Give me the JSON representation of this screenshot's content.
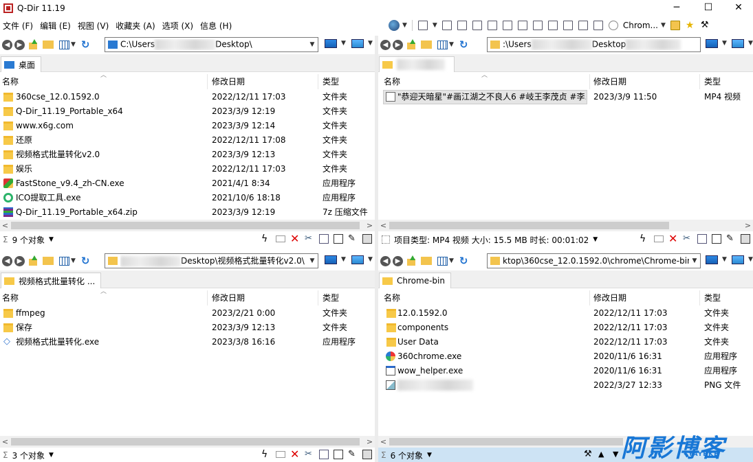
{
  "window": {
    "title": "Q-Dir 11.19",
    "min": "─",
    "max": "☐",
    "close": "✕"
  },
  "menu": [
    "文件 (F)",
    "编辑 (E)",
    "视图 (V)",
    "收藏夹 (A)",
    "选项 (X)",
    "信息 (H)"
  ],
  "toolbar": {
    "browser_label": "Chrom..."
  },
  "columns": {
    "name": "名称",
    "date": "修改日期",
    "type": "类型"
  },
  "panes": {
    "tl": {
      "address": "C:\\Users",
      "address_tail": "Desktop\\",
      "tab": "桌面",
      "rows": [
        {
          "name": "360cse_12.0.1592.0",
          "date": "2022/12/11 17:03",
          "type": "文件夹",
          "icon": "folder-icon"
        },
        {
          "name": "Q-Dir_11.19_Portable_x64",
          "date": "2023/3/9 12:19",
          "type": "文件夹",
          "icon": "folder-icon"
        },
        {
          "name": "www.x6g.com",
          "date": "2023/3/9 12:14",
          "type": "文件夹",
          "icon": "folder-icon"
        },
        {
          "name": "还原",
          "date": "2022/12/11 17:08",
          "type": "文件夹",
          "icon": "folder-icon"
        },
        {
          "name": "视频格式批量转化v2.0",
          "date": "2023/3/9 12:13",
          "type": "文件夹",
          "icon": "folder-icon"
        },
        {
          "name": "娱乐",
          "date": "2022/12/11 17:03",
          "type": "文件夹",
          "icon": "folder-icon"
        },
        {
          "name": "FastStone_v9.4_zh-CN.exe",
          "date": "2021/4/1 8:34",
          "type": "应用程序",
          "icon": "faststone-icon"
        },
        {
          "name": "ICO提取工具.exe",
          "date": "2021/10/6 18:18",
          "type": "应用程序",
          "icon": "ico-tool-icon"
        },
        {
          "name": "Q-Dir_11.19_Portable_x64.zip",
          "date": "2023/3/9 12:19",
          "type": "7z 压缩文件",
          "icon": "archive-icon"
        }
      ],
      "status": "9 个对象"
    },
    "tr": {
      "address": ":\\Users",
      "address_tail": "Desktop",
      "tab": "",
      "rows": [
        {
          "name": "\"恭迎天暗星\"#画江湖之不良人6 #岐王李茂贞 #李...",
          "date": "2023/3/9 11:50",
          "type": "MP4 视频",
          "icon": "video-icon"
        }
      ],
      "status": "项目类型: MP4 视频 大小: 15.5 MB 时长: 00:01:02"
    },
    "bl": {
      "address": "",
      "address_tail": "Desktop\\视频格式批量转化v2.0\\",
      "tab": "视频格式批量转化 ...",
      "rows": [
        {
          "name": "ffmpeg",
          "date": "2023/2/21 0:00",
          "type": "文件夹",
          "icon": "folder-icon"
        },
        {
          "name": "保存",
          "date": "2023/3/9 12:13",
          "type": "文件夹",
          "icon": "folder-icon"
        },
        {
          "name": "视频格式批量转化.exe",
          "date": "2023/3/8 16:16",
          "type": "应用程序",
          "icon": "app-icon"
        }
      ],
      "status": "3 个对象"
    },
    "br": {
      "address": "ktop\\360cse_12.0.1592.0\\chrome\\Chrome-bin\\",
      "tab": "Chrome-bin",
      "rows": [
        {
          "name": "12.0.1592.0",
          "date": "2022/12/11 17:03",
          "type": "文件夹",
          "icon": "folder-icon"
        },
        {
          "name": "components",
          "date": "2022/12/11 17:03",
          "type": "文件夹",
          "icon": "folder-icon"
        },
        {
          "name": "User Data",
          "date": "2022/12/11 17:03",
          "type": "文件夹",
          "icon": "folder-icon"
        },
        {
          "name": "360chrome.exe",
          "date": "2020/11/6 16:31",
          "type": "应用程序",
          "icon": "360chrome-icon"
        },
        {
          "name": "wow_helper.exe",
          "date": "2020/11/6 16:31",
          "type": "应用程序",
          "icon": "exe-icon"
        },
        {
          "name": "",
          "date": "2022/3/27 12:33",
          "type": "PNG 文件",
          "icon": "png-icon"
        }
      ],
      "status": "6 个对象"
    }
  },
  "status_sigma": "Σ",
  "watermark": {
    "text": "阿影博客",
    "sub": "YAYBKE"
  }
}
